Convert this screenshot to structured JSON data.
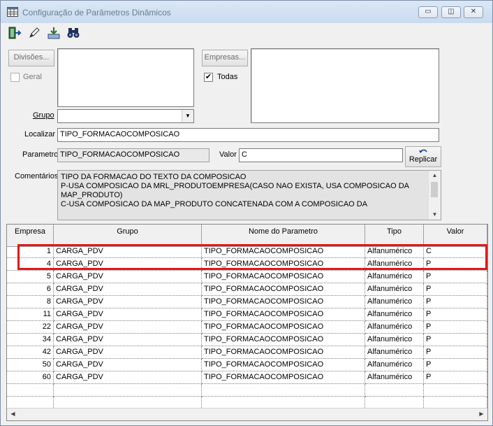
{
  "window": {
    "title": "Configuração de Parâmetros Dinâmicos",
    "minimize_glyph": "▭",
    "restore_glyph": "◫",
    "close_glyph": "✕"
  },
  "toolbar": {
    "icons": [
      "exit-door-icon",
      "pencil-icon",
      "download-tray-icon",
      "binoculars-icon"
    ]
  },
  "form": {
    "divisoes_button": "Divisões...",
    "geral_label": "Geral",
    "geral_checked": false,
    "empresas_button": "Empresas...",
    "todas_label": "Todas",
    "todas_checked": true,
    "grupo_label": "Grupo",
    "grupo_value": "",
    "localizar_label": "Localizar",
    "localizar_value": "TIPO_FORMACAOCOMPOSICAO",
    "parametro_label": "Parametro",
    "parametro_value": "TIPO_FORMACAOCOMPOSICAO",
    "valor_label": "Valor",
    "valor_value": "C",
    "replicar_button": "Replicar",
    "comentarios_label": "Comentários",
    "comentarios_lines": [
      "TIPO DA FORMACAO DO TEXTO DA COMPOSICAO",
      "P-USA COMPOSICAO DA MRL_PRODUTOEMPRESA(CASO NAO EXISTA, USA COMPOSICAO DA",
      "MAP_PRODUTO)",
      "C-USA COMPOSICAO DA MAP_PRODUTO CONCATENADA COM A COMPOSICAO DA"
    ]
  },
  "grid": {
    "headers": [
      "Empresa",
      "Grupo",
      "Nome do Parametro",
      "Tipo",
      "Valor"
    ],
    "rows": [
      [
        "1",
        "CARGA_PDV",
        "TIPO_FORMACAOCOMPOSICAO",
        "Alfanumérico",
        "C"
      ],
      [
        "4",
        "CARGA_PDV",
        "TIPO_FORMACAOCOMPOSICAO",
        "Alfanumérico",
        "P"
      ],
      [
        "5",
        "CARGA_PDV",
        "TIPO_FORMACAOCOMPOSICAO",
        "Alfanumérico",
        "P"
      ],
      [
        "6",
        "CARGA_PDV",
        "TIPO_FORMACAOCOMPOSICAO",
        "Alfanumérico",
        "P"
      ],
      [
        "8",
        "CARGA_PDV",
        "TIPO_FORMACAOCOMPOSICAO",
        "Alfanumérico",
        "P"
      ],
      [
        "11",
        "CARGA_PDV",
        "TIPO_FORMACAOCOMPOSICAO",
        "Alfanumérico",
        "P"
      ],
      [
        "22",
        "CARGA_PDV",
        "TIPO_FORMACAOCOMPOSICAO",
        "Alfanumérico",
        "P"
      ],
      [
        "34",
        "CARGA_PDV",
        "TIPO_FORMACAOCOMPOSICAO",
        "Alfanumérico",
        "P"
      ],
      [
        "42",
        "CARGA_PDV",
        "TIPO_FORMACAOCOMPOSICAO",
        "Alfanumérico",
        "P"
      ],
      [
        "50",
        "CARGA_PDV",
        "TIPO_FORMACAOCOMPOSICAO",
        "Alfanumérico",
        "P"
      ],
      [
        "60",
        "CARGA_PDV",
        "TIPO_FORMACAOCOMPOSICAO",
        "Alfanumérico",
        "P"
      ],
      [
        "",
        "",
        "",
        "",
        ""
      ],
      [
        "",
        "",
        "",
        "",
        ""
      ]
    ],
    "highlight_color": "#e01818"
  }
}
